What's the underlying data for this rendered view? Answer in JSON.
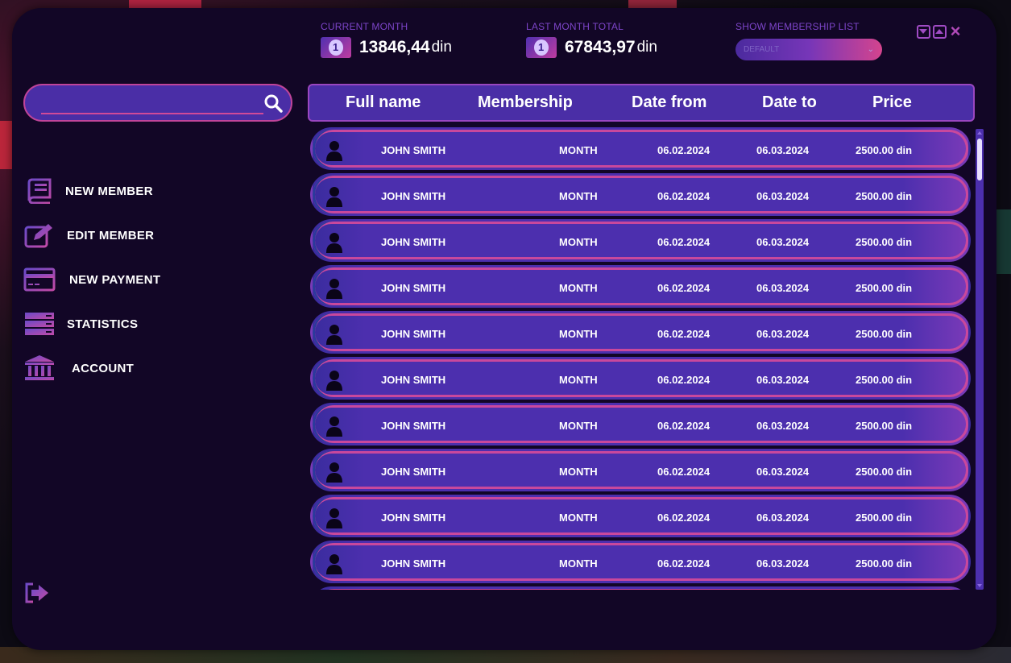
{
  "header": {
    "current_month": {
      "label": "CURRENT MONTH",
      "value": "13846,44",
      "unit": "din",
      "icon": "money-bill-icon"
    },
    "last_month_total": {
      "label": "LAST MONTH TOTAL",
      "value": "67843,97",
      "unit": "din",
      "icon": "money-bill-icon"
    },
    "membership_list": {
      "label": "SHOW MEMBERSHIP LIST",
      "selected": "DEFAULT"
    }
  },
  "window_controls": [
    "minimize-icon",
    "maximize-icon",
    "close-icon"
  ],
  "search": {
    "placeholder": "",
    "value": ""
  },
  "sidebar": {
    "items": [
      {
        "label": "NEW MEMBER",
        "icon": "book-icon"
      },
      {
        "label": "EDIT MEMBER",
        "icon": "edit-icon"
      },
      {
        "label": "NEW PAYMENT",
        "icon": "credit-card-icon"
      },
      {
        "label": "STATISTICS",
        "icon": "server-icon"
      },
      {
        "label": "ACCOUNT",
        "icon": "bank-icon"
      }
    ],
    "logout_icon": "logout-icon"
  },
  "table": {
    "columns": [
      "Full name",
      "Membership",
      "Date from",
      "Date to",
      "Price"
    ],
    "rows": [
      {
        "name": "JOHN SMITH",
        "membership": "MONTH",
        "from": "06.02.2024",
        "to": "06.03.2024",
        "price": "2500.00 din"
      },
      {
        "name": "JOHN SMITH",
        "membership": "MONTH",
        "from": "06.02.2024",
        "to": "06.03.2024",
        "price": "2500.00 din"
      },
      {
        "name": "JOHN SMITH",
        "membership": "MONTH",
        "from": "06.02.2024",
        "to": "06.03.2024",
        "price": "2500.00 din"
      },
      {
        "name": "JOHN SMITH",
        "membership": "MONTH",
        "from": "06.02.2024",
        "to": "06.03.2024",
        "price": "2500.00 din"
      },
      {
        "name": "JOHN SMITH",
        "membership": "MONTH",
        "from": "06.02.2024",
        "to": "06.03.2024",
        "price": "2500.00 din"
      },
      {
        "name": "JOHN SMITH",
        "membership": "MONTH",
        "from": "06.02.2024",
        "to": "06.03.2024",
        "price": "2500.00 din"
      },
      {
        "name": "JOHN SMITH",
        "membership": "MONTH",
        "from": "06.02.2024",
        "to": "06.03.2024",
        "price": "2500.00 din"
      },
      {
        "name": "JOHN SMITH",
        "membership": "MONTH",
        "from": "06.02.2024",
        "to": "06.03.2024",
        "price": "2500.00 din"
      },
      {
        "name": "JOHN SMITH",
        "membership": "MONTH",
        "from": "06.02.2024",
        "to": "06.03.2024",
        "price": "2500.00 din"
      },
      {
        "name": "JOHN SMITH",
        "membership": "MONTH",
        "from": "06.02.2024",
        "to": "06.03.2024",
        "price": "2500.00 din"
      }
    ]
  },
  "colors": {
    "window_bg": "#120626",
    "accent_purple": "#4c2fae",
    "accent_pink": "#c9489c",
    "label_purple": "#7d45c9"
  }
}
